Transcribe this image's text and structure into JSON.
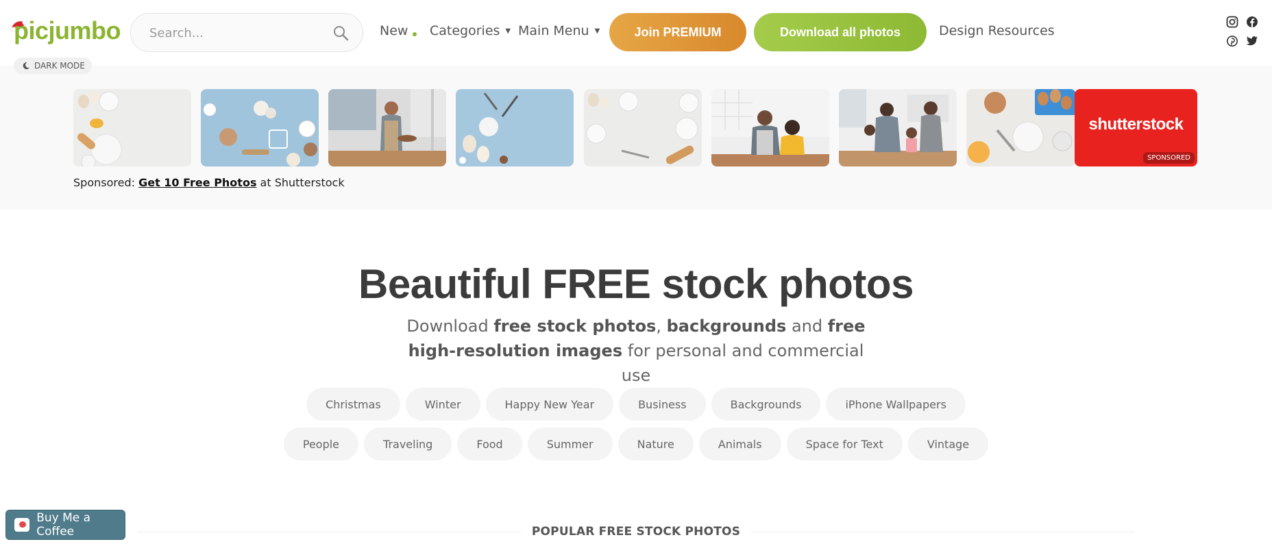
{
  "header": {
    "logo_text": "picjumbo",
    "search": {
      "placeholder": "Search..."
    },
    "nav": {
      "new_label": "New",
      "categories_label": "Categories",
      "main_menu_label": "Main Menu",
      "design_resources_label": "Design Resources"
    },
    "premium_label": "Join PREMIUM",
    "download_label": "Download all photos",
    "dark_mode_label": "DARK MODE",
    "social_icons": [
      "instagram-icon",
      "facebook-icon",
      "pinterest-icon",
      "twitter-icon"
    ]
  },
  "sponsored": {
    "thumbnails": [
      "eggs-and-rolling-pin-photo",
      "blue-baking-table-photo",
      "woman-baking-in-kitchen-photo",
      "blue-baking-flatlay-photo",
      "white-baking-flatlay-photo",
      "father-and-child-baking-photo",
      "family-baking-together-photo",
      "eggs-and-flour-photo"
    ],
    "shutterstock_logo": "shutterstock",
    "badge": "SPONSORED",
    "line_prefix": "Sponsored: ",
    "line_link": "Get 10 Free Photos",
    "line_suffix": " at Shutterstock"
  },
  "hero": {
    "title": "Beautiful FREE stock photos",
    "sub_1": "Download ",
    "sub_b1": "free stock photos",
    "sub_2": ", ",
    "sub_b2": "backgrounds",
    "sub_3": " and ",
    "sub_b3": "free high-resolution images",
    "sub_4": " for personal and commercial use"
  },
  "tags_row_1": [
    "Christmas",
    "Winter",
    "Happy New Year",
    "Business",
    "Backgrounds",
    "iPhone Wallpapers"
  ],
  "tags_row_2": [
    "People",
    "Traveling",
    "Food",
    "Summer",
    "Nature",
    "Animals",
    "Space for Text",
    "Vintage"
  ],
  "popular_title": "POPULAR FREE STOCK PHOTOS",
  "coffee_label": "Buy Me a Coffee",
  "colors": {
    "brand_green": "#8bb431",
    "premium_orange": "#dd9a3a",
    "shutterstock_red": "#e8221f"
  }
}
